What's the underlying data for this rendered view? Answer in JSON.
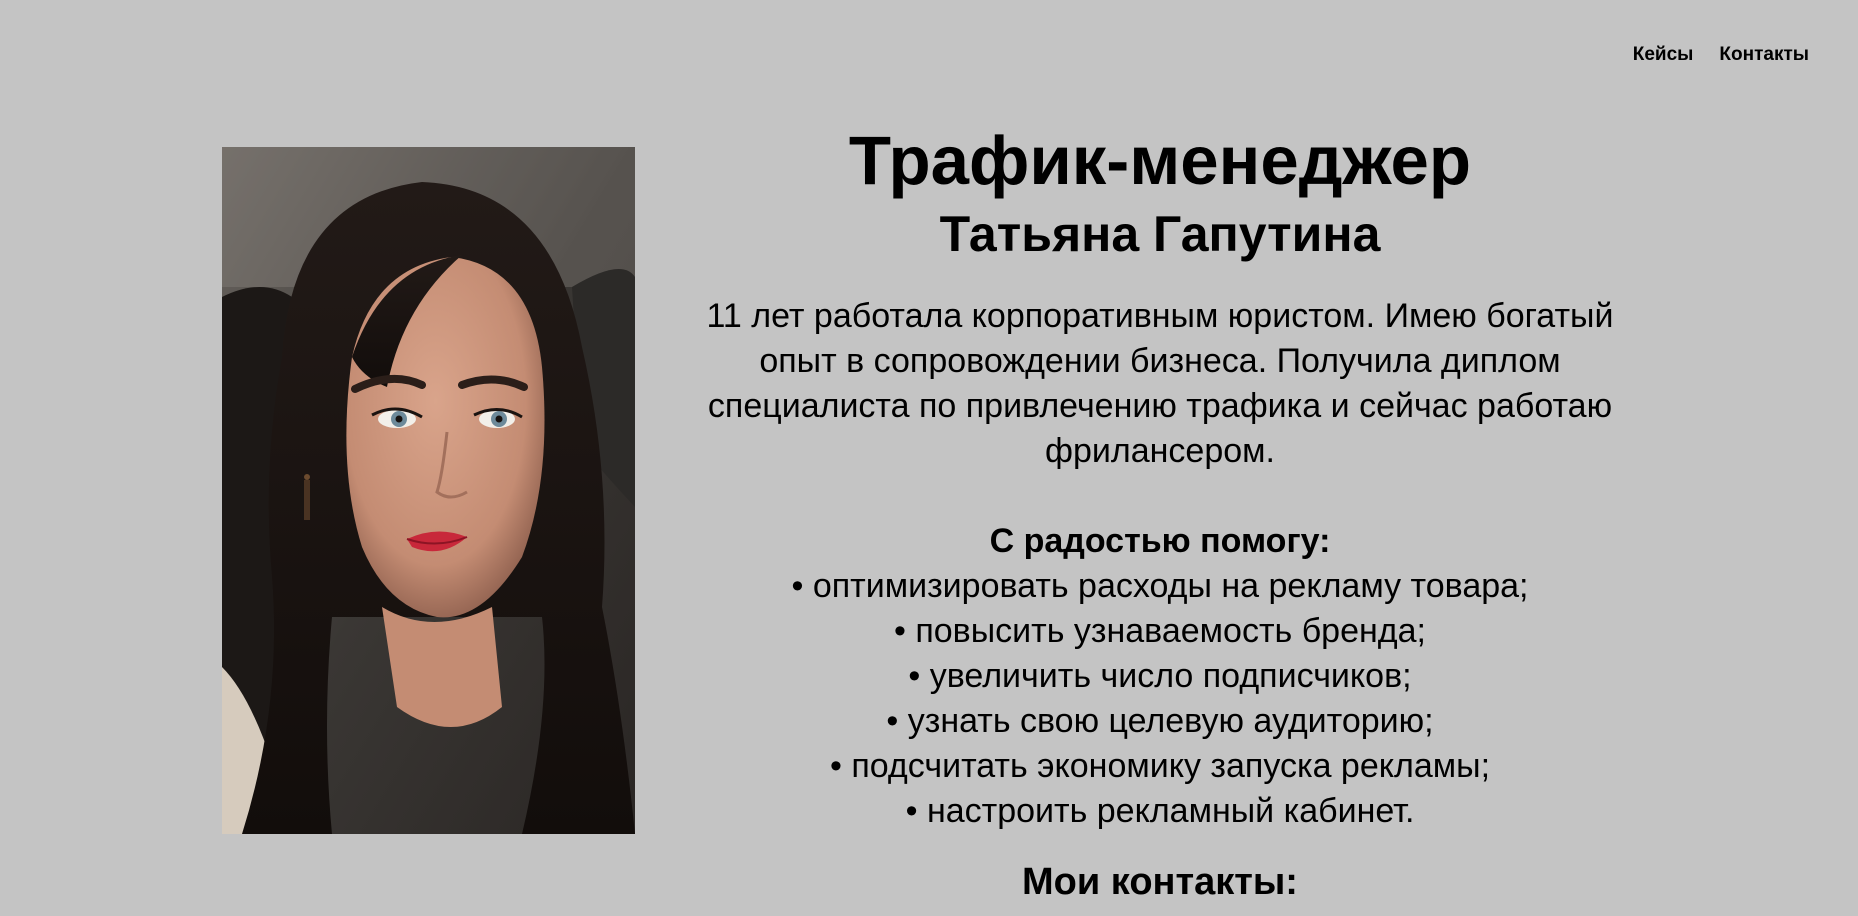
{
  "nav": {
    "items": [
      {
        "label": "Кейсы"
      },
      {
        "label": "Контакты"
      }
    ]
  },
  "hero": {
    "title": "Трафик-менеджер",
    "name": "Татьяна Гапутина",
    "bio": "11 лет работала корпоративным юристом. Имею богатый опыт в сопровождении бизнеса. Получила диплом специалиста по привлечению трафика и сейчас работаю фрилансером.",
    "help_heading": "С радостью помогу:",
    "help_items": [
      "• оптимизировать расходы на рекламу товара;",
      "• повысить узнаваемость бренда;",
      "• увеличить число подписчиков;",
      "• узнать свою целевую аудиторию;",
      "• подсчитать экономику запуска рекламы;",
      "• настроить рекламный кабинет."
    ],
    "contacts_heading": "Мои контакты:"
  },
  "colors": {
    "background": "#c4c4c4",
    "text": "#000000"
  }
}
